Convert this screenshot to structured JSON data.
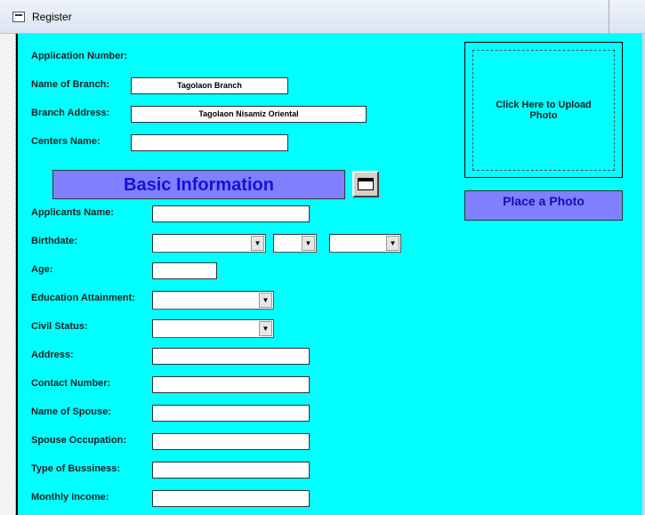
{
  "window": {
    "title": "Register",
    "icon": "form-icon"
  },
  "header_fields": {
    "application_number_label": "Application Number:",
    "branch_name_label": "Name of Branch:",
    "branch_name_value": "Tagolaon Branch",
    "branch_address_label": "Branch Address:",
    "branch_address_value": "Tagolaon Nisamiz Oriental",
    "centers_name_label": "Centers Name:",
    "centers_name_value": ""
  },
  "section": {
    "title": "Basic Information",
    "calendar_icon": "calendar-icon"
  },
  "photo": {
    "upload_text": "Click Here to Upload Photo",
    "place_button": "Place a Photo"
  },
  "fields": {
    "applicants_name": "Applicants Name:",
    "birthdate": "Birthdate:",
    "age": "Age:",
    "education": "Education Attainment:",
    "civil_status": "Civil Status:",
    "address": "Address:",
    "contact": "Contact Number:",
    "spouse_name": "Name of Spouse:",
    "spouse_occupation": "Spouse Occupation:",
    "business_type": "Type of Bussiness:",
    "monthly_income": "Monthly Income:"
  }
}
